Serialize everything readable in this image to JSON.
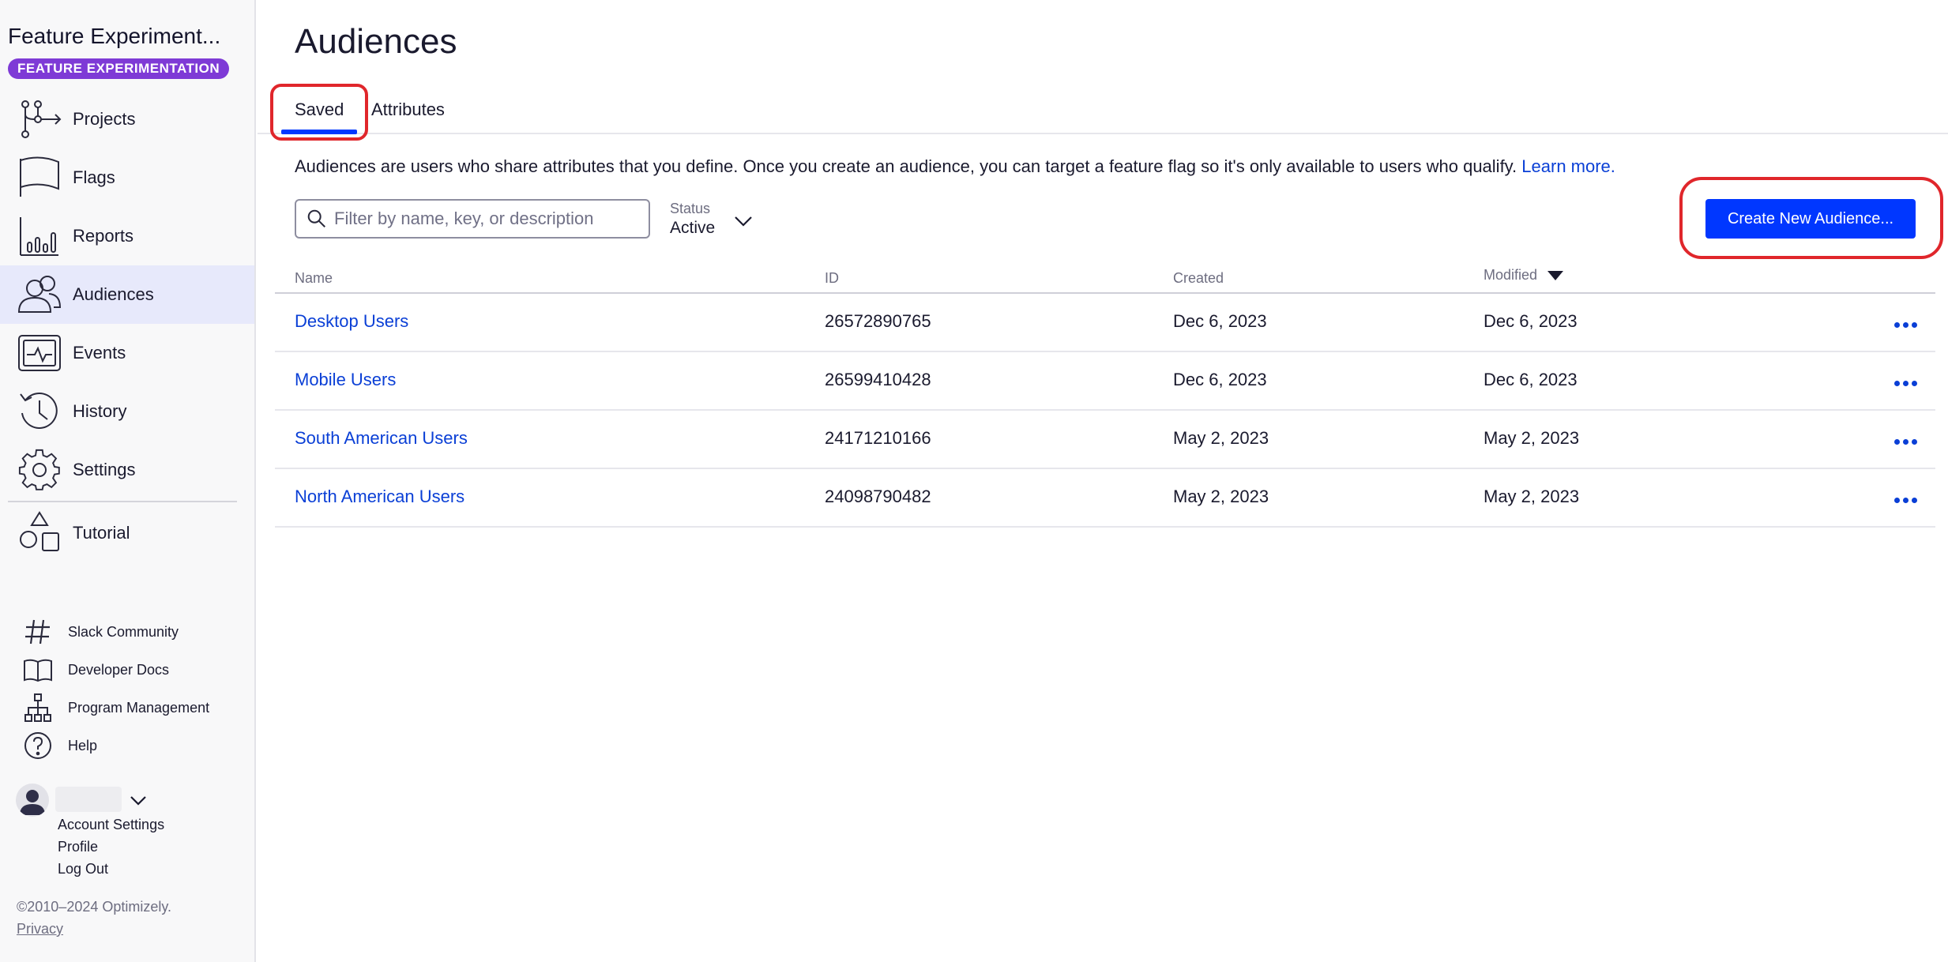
{
  "sidebar": {
    "app_title": "Feature Experiment...",
    "product_badge": "FEATURE EXPERIMENTATION",
    "nav": [
      {
        "label": "Projects",
        "icon": "projects-icon"
      },
      {
        "label": "Flags",
        "icon": "flag-icon"
      },
      {
        "label": "Reports",
        "icon": "reports-icon"
      },
      {
        "label": "Audiences",
        "icon": "audiences-icon",
        "active": true
      },
      {
        "label": "Events",
        "icon": "events-icon"
      },
      {
        "label": "History",
        "icon": "history-icon"
      },
      {
        "label": "Settings",
        "icon": "gear-icon"
      },
      {
        "label": "Tutorial",
        "icon": "tutorial-shapes-icon"
      }
    ],
    "links": [
      {
        "label": "Slack Community",
        "icon": "hash-icon"
      },
      {
        "label": "Developer Docs",
        "icon": "book-icon"
      },
      {
        "label": "Program Management",
        "icon": "org-chart-icon"
      },
      {
        "label": "Help",
        "icon": "help-icon"
      }
    ],
    "account": {
      "links": [
        "Account Settings",
        "Profile",
        "Log Out"
      ]
    },
    "copyright": "©2010–2024 Optimizely.",
    "privacy": "Privacy"
  },
  "main": {
    "title": "Audiences",
    "tabs": [
      {
        "label": "Saved",
        "active": true
      },
      {
        "label": "Attributes"
      }
    ],
    "description": "Audiences are users who share attributes that you define. Once you create an audience, you can target a feature flag so it's only available to users who qualify.",
    "learn_more": "Learn more.",
    "search_placeholder": "Filter by name, key, or description",
    "status": {
      "label": "Status",
      "value": "Active"
    },
    "create_button": "Create New Audience...",
    "table": {
      "columns": [
        "Name",
        "ID",
        "Created",
        "Modified"
      ],
      "sort_column": "Modified",
      "sort_direction": "desc",
      "rows": [
        {
          "name": "Desktop Users",
          "id": "26572890765",
          "created": "Dec 6, 2023",
          "modified": "Dec 6, 2023"
        },
        {
          "name": "Mobile Users",
          "id": "26599410428",
          "created": "Dec 6, 2023",
          "modified": "Dec 6, 2023"
        },
        {
          "name": "South American Users",
          "id": "24171210166",
          "created": "May 2, 2023",
          "modified": "May 2, 2023"
        },
        {
          "name": "North American Users",
          "id": "24098790482",
          "created": "May 2, 2023",
          "modified": "May 2, 2023"
        }
      ]
    }
  },
  "colors": {
    "accent": "#0037ff",
    "link": "#0a3fd6",
    "badge": "#7e3ad6",
    "highlight": "#e0262b",
    "active_nav": "#e7e9fb"
  }
}
